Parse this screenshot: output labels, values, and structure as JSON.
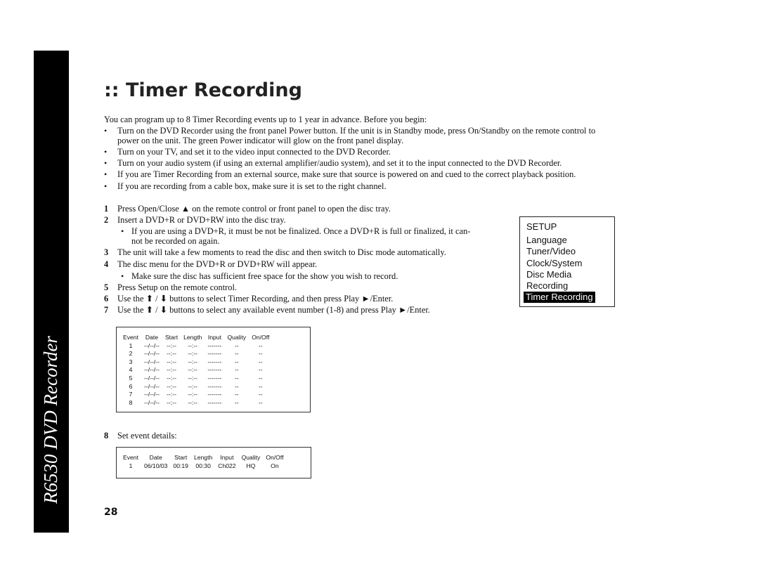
{
  "sidebar": {
    "product": "R6530 DVD Recorder"
  },
  "title": ":: Timer Recording",
  "intro": "You can program up to 8 Timer Recording events up to 1 year in advance. Before you begin:",
  "bullets": [
    "Turn on the DVD Recorder using the front panel Power button. If the unit is in Standby mode, press On/Standby on the remote control to",
    "power on the unit. The green Power indicator will glow on the front panel display.",
    "Turn on your TV, and set it to the video input connected to the DVD Recorder.",
    "Turn on your audio system (if using an external amplifier/audio system), and set it to the input connected to the DVD Recorder.",
    "If you are Timer Recording from an external source, make sure that source is powered on and cued to the correct playback position.",
    "If you are recording from a cable box, make sure it is set to the right channel."
  ],
  "steps": {
    "s1": "Press Open/Close ▲ on the remote control or front panel to open the disc tray.",
    "s2": "Insert a DVD+R or DVD+RW into the disc tray.",
    "s2a": "If you are using a DVD+R, it must be not be finalized. Once a DVD+R is full or finalized, it can-",
    "s2b": "not be recorded on again.",
    "s3": "The unit will take a few moments to read the disc and then switch to Disc mode automatically.",
    "s4": "The disc menu for the DVD+R or DVD+RW will appear.",
    "s4a": "Make sure the disc has sufficient free space for the show you wish to record.",
    "s5": "Press Setup on the remote control.",
    "s6": "Use the ⬆ / ⬇ buttons to select Timer Recording, and then press Play ►/Enter.",
    "s7": "Use the ⬆ / ⬇ buttons to select any available event number (1-8) and press Play ►/Enter.",
    "s8": "Set event details:"
  },
  "step_numbers": [
    "1",
    "2",
    "3",
    "4",
    "5",
    "6",
    "7",
    "8"
  ],
  "setup_menu": {
    "title": "SETUP",
    "items": [
      "Language",
      "Tuner/Video",
      "Clock/System",
      "Disc Media",
      "Recording",
      "Timer Recording"
    ],
    "selected": "Timer Recording"
  },
  "event_table": {
    "headers": [
      "Event",
      "Date",
      "Start",
      "Length",
      "Input",
      "Quality",
      "On/Off"
    ],
    "rows": [
      [
        "1",
        "--/--/--",
        "--:--",
        "--:--",
        "-------",
        "--",
        "--"
      ],
      [
        "2",
        "--/--/--",
        "--:--",
        "--:--",
        "-------",
        "--",
        "--"
      ],
      [
        "3",
        "--/--/--",
        "--:--",
        "--:--",
        "-------",
        "--",
        "--"
      ],
      [
        "4",
        "--/--/--",
        "--:--",
        "--:--",
        "-------",
        "--",
        "--"
      ],
      [
        "5",
        "--/--/--",
        "--:--",
        "--:--",
        "-------",
        "--",
        "--"
      ],
      [
        "6",
        "--/--/--",
        "--:--",
        "--:--",
        "-------",
        "--",
        "--"
      ],
      [
        "7",
        "--/--/--",
        "--:--",
        "--:--",
        "-------",
        "--",
        "--"
      ],
      [
        "8",
        "--/--/--",
        "--:--",
        "--:--",
        "-------",
        "--",
        "--"
      ]
    ]
  },
  "detail_table": {
    "headers": [
      "Event",
      "Date",
      "Start",
      "Length",
      "Input",
      "Quality",
      "On/Off"
    ],
    "rows": [
      [
        "1",
        "06/10/03",
        "00:19",
        "00:30",
        "Ch022",
        "HQ",
        "On"
      ]
    ]
  },
  "page_number": "28"
}
